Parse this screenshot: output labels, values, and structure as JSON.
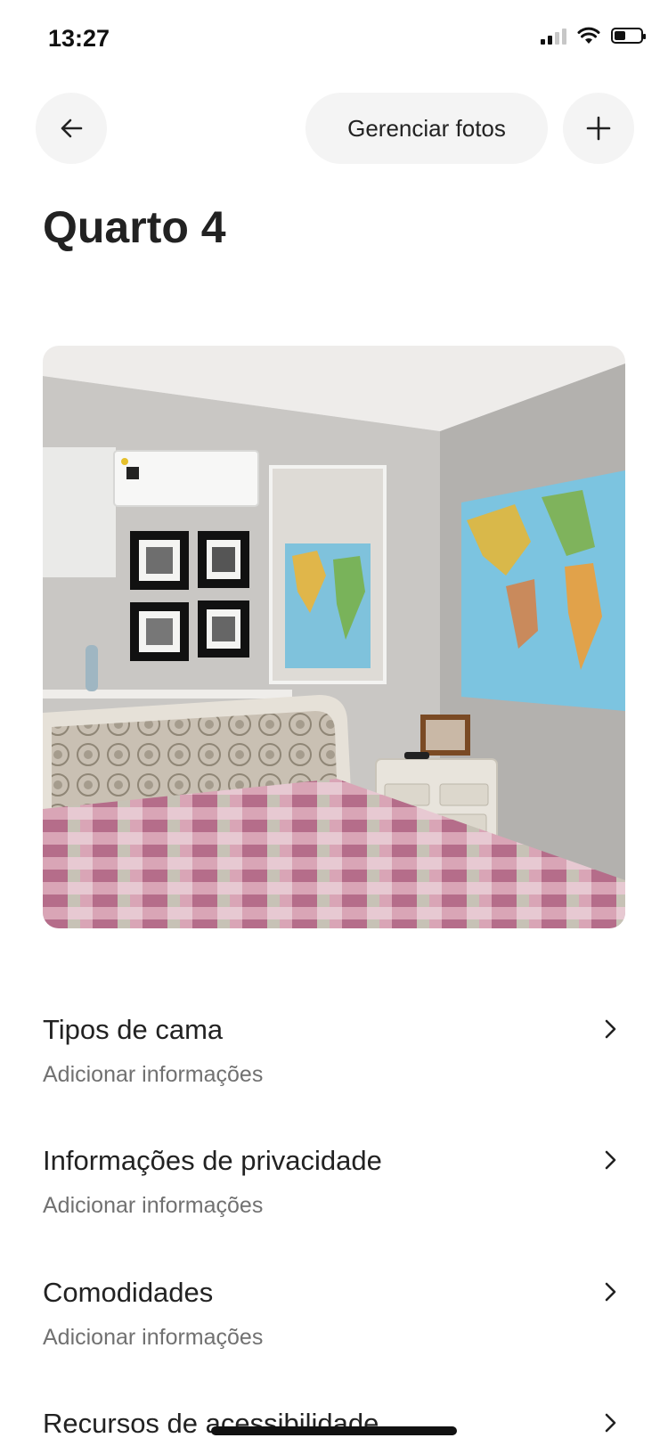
{
  "status_bar": {
    "time": "13:27"
  },
  "header": {
    "manage_photos_label": "Gerenciar fotos"
  },
  "page": {
    "title": "Quarto 4"
  },
  "photo": {
    "subject": "bedroom-photo"
  },
  "sections": [
    {
      "label": "Tipos de cama",
      "sub": "Adicionar informações"
    },
    {
      "label": "Informações de privacidade",
      "sub": "Adicionar informações"
    },
    {
      "label": "Comodidades",
      "sub": "Adicionar informações"
    },
    {
      "label": "Recursos de acessibilidade"
    }
  ],
  "icons": {
    "back": "arrow-left-icon",
    "add": "plus-icon",
    "chevron": "chevron-right-icon"
  },
  "colors": {
    "text_primary": "#222222",
    "text_secondary": "#717171",
    "button_bg": "#f4f4f4"
  }
}
